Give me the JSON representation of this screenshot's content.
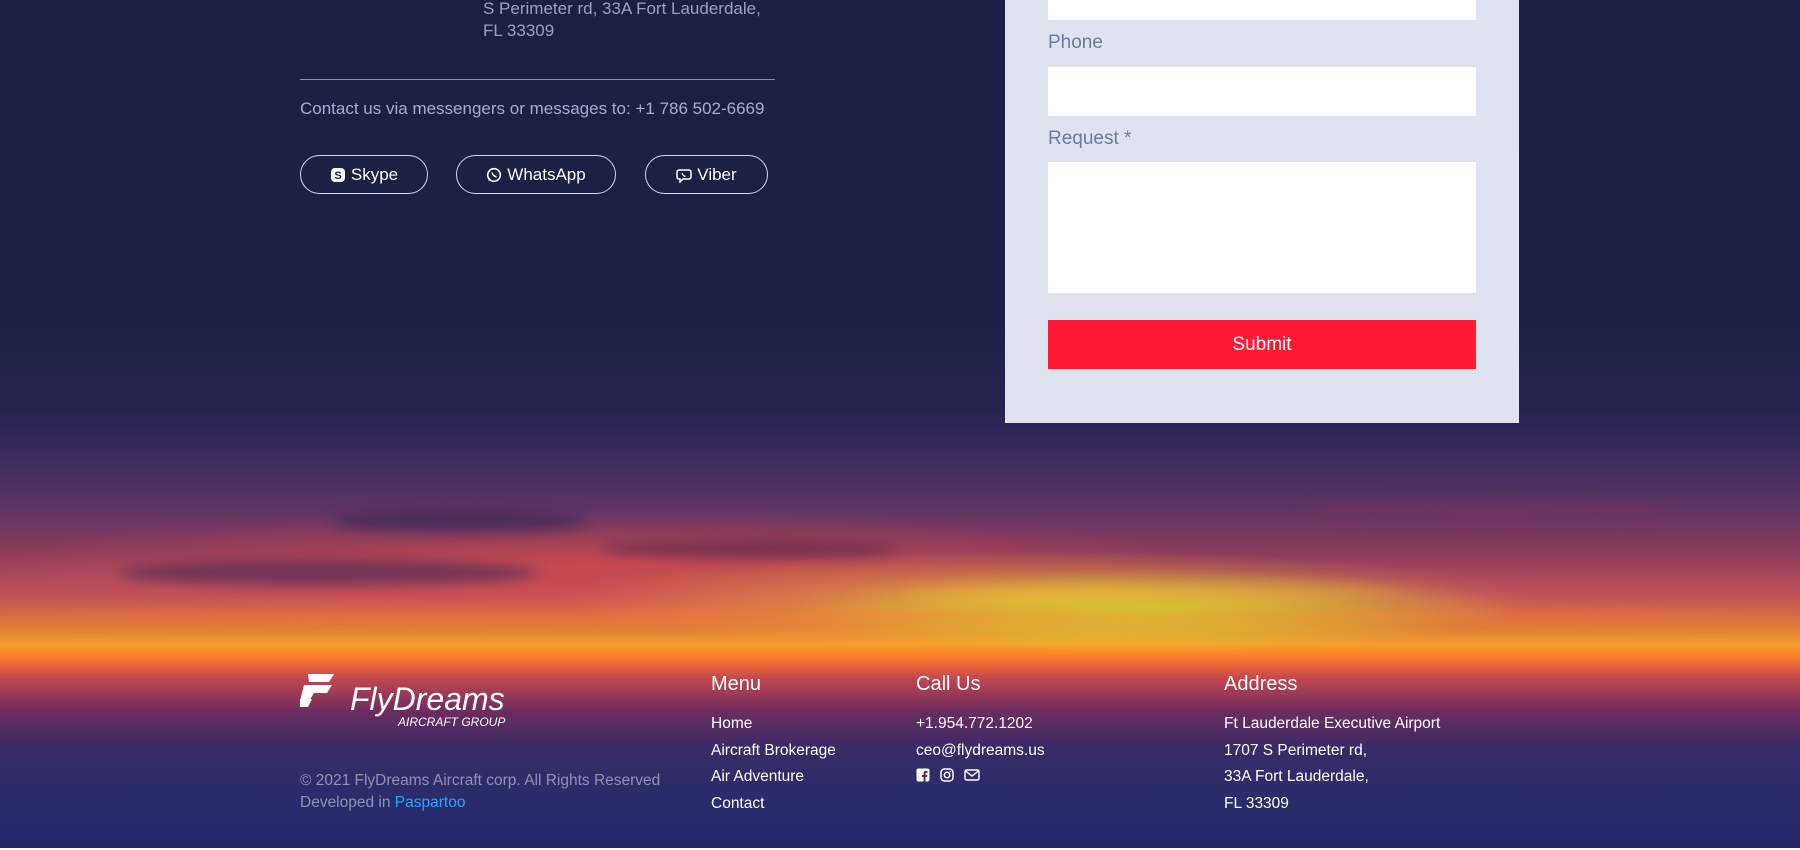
{
  "contact": {
    "address_tail_line1": "S Perimeter rd, 33A Fort Lauderdale,",
    "address_tail_line2": "FL 33309",
    "messenger_text": "Contact us via messengers or messages to: +1 786 502-6669",
    "buttons": [
      {
        "label": "Skype",
        "icon": "skype-icon"
      },
      {
        "label": "WhatsApp",
        "icon": "whatsapp-icon"
      },
      {
        "label": "Viber",
        "icon": "viber-icon"
      }
    ]
  },
  "form": {
    "phone_label": "Phone",
    "phone_value": "",
    "request_label": "Request *",
    "request_value": "",
    "submit_label": "Submit"
  },
  "footer": {
    "logo_brand": "FlyDreams",
    "logo_sub": "AIRCRAFT GROUP",
    "copyright": "© 2021 FlyDreams Aircraft corp. All Rights Reserved",
    "developed_prefix": "Developed in",
    "developed_link": "Paspartoo",
    "menu": {
      "title": "Menu",
      "items": [
        "Home",
        "Aircraft Brokerage",
        "Air Adventure",
        "Contact"
      ]
    },
    "call": {
      "title": "Call Us",
      "phone": "+1.954.772.1202",
      "email": "ceo@flydreams.us",
      "social_icons": [
        "facebook-icon",
        "instagram-icon",
        "mail-icon"
      ]
    },
    "address": {
      "title": "Address",
      "lines": [
        "Ft Lauderdale Executive Airport",
        "1707 S Perimeter rd,",
        "33A Fort Lauderdale,",
        "FL 33309"
      ]
    }
  },
  "colors": {
    "accent": "#ff1a33",
    "link": "#2aa3ff",
    "form_bg": "#dfe3ef",
    "night_bg": "#1b1f45"
  }
}
